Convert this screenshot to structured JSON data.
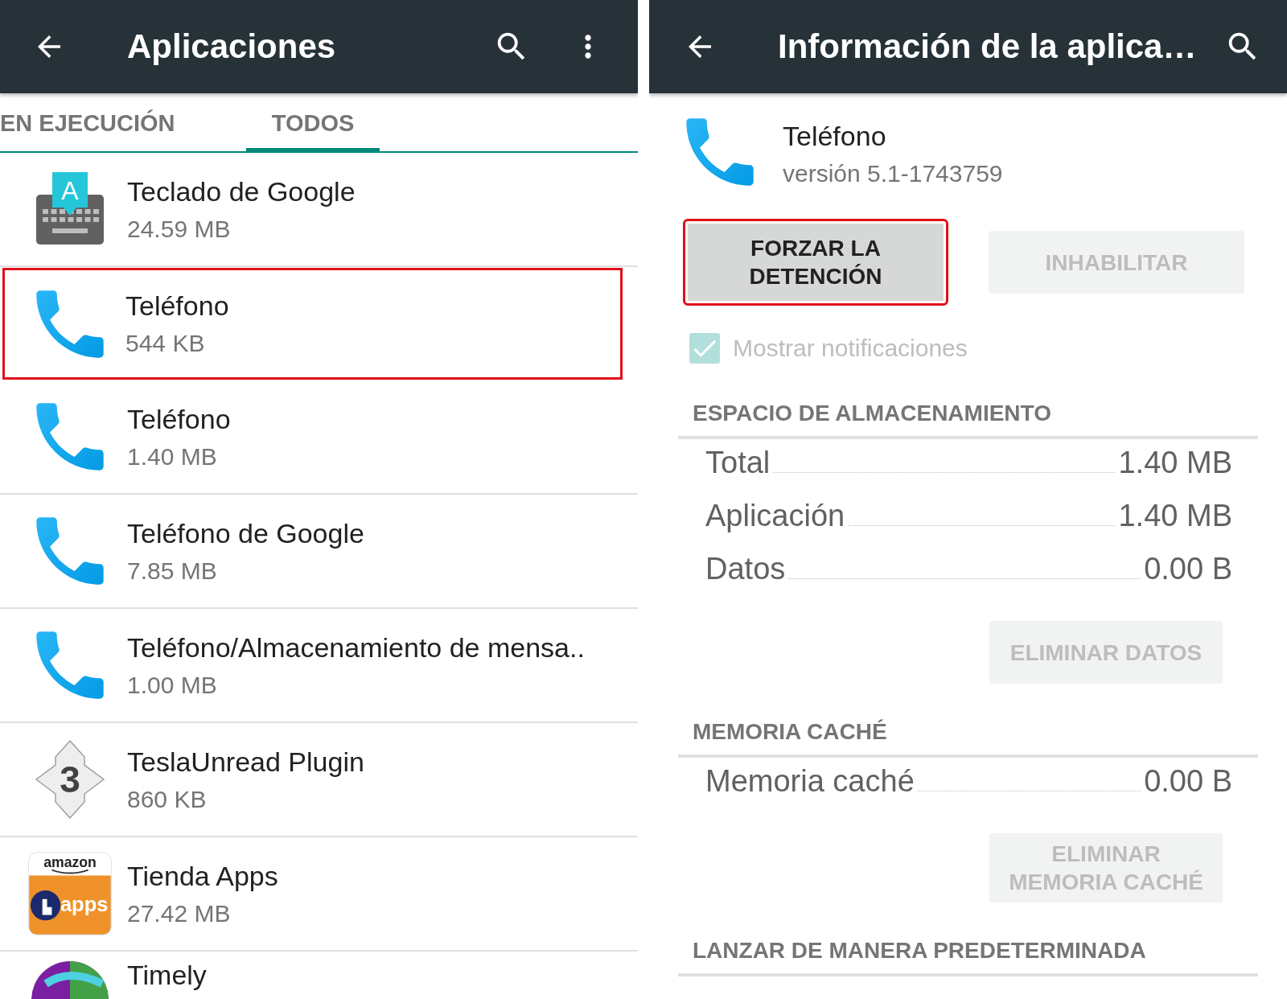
{
  "left": {
    "app_bar": {
      "title": "Aplicaciones"
    },
    "tabs": [
      {
        "label": "EN EJECUCIÓN",
        "selected": false
      },
      {
        "label": "TODOS",
        "selected": true
      }
    ],
    "apps": [
      {
        "kind": "keyboard",
        "icon_text": [
          "A"
        ],
        "name": "Teclado de Google",
        "size": "24.59 MB",
        "highlighted": false
      },
      {
        "kind": "phone",
        "name": "Teléfono",
        "size": "544 KB",
        "highlighted": true
      },
      {
        "kind": "phone",
        "name": "Teléfono",
        "size": "1.40 MB",
        "highlighted": false
      },
      {
        "kind": "phone",
        "name": "Teléfono de Google",
        "size": "7.85 MB",
        "highlighted": false
      },
      {
        "kind": "phone",
        "name": "Teléfono/Almacenamiento de mensa..",
        "size": "1.00 MB",
        "highlighted": false
      },
      {
        "kind": "badge",
        "icon_text": [
          "3"
        ],
        "name": "TeslaUnread Plugin",
        "size": "860 KB",
        "highlighted": false
      },
      {
        "kind": "store",
        "icon_text": [
          "amazon",
          "apps"
        ],
        "name": "Tienda Apps",
        "size": "27.42 MB",
        "highlighted": false
      },
      {
        "kind": "swirl",
        "name": "Timely",
        "highlighted": false
      }
    ]
  },
  "right": {
    "app_bar": {
      "title": "Información de la aplica…"
    },
    "app": {
      "kind": "phone",
      "name": "Teléfono",
      "version": "versión 5.1-1743759"
    },
    "buttons": [
      {
        "label": "FORZAR LA DETENCIÓN",
        "disabled": false,
        "highlighted": true
      },
      {
        "label": "INHABILITAR",
        "disabled": true,
        "highlighted": false
      }
    ],
    "notifications": {
      "label": "Mostrar notificaciones",
      "checked": true,
      "disabled": true
    },
    "sections": [
      {
        "title": "ESPACIO DE ALMACENAMIENTO",
        "rows": [
          {
            "label": "Total",
            "value": "1.40 MB"
          },
          {
            "label": "Aplicación",
            "value": "1.40 MB"
          },
          {
            "label": "Datos",
            "value": "0.00 B"
          }
        ],
        "button": {
          "label": "ELIMINAR DATOS",
          "disabled": true
        }
      },
      {
        "title": "MEMORIA CACHÉ",
        "rows": [
          {
            "label": "Memoria caché",
            "value": "0.00 B"
          }
        ],
        "button": {
          "label": "ELIMINAR MEMORIA CACHÉ",
          "disabled": true
        }
      },
      {
        "title": "LANZAR DE MANERA PREDETERMINADA"
      }
    ]
  }
}
